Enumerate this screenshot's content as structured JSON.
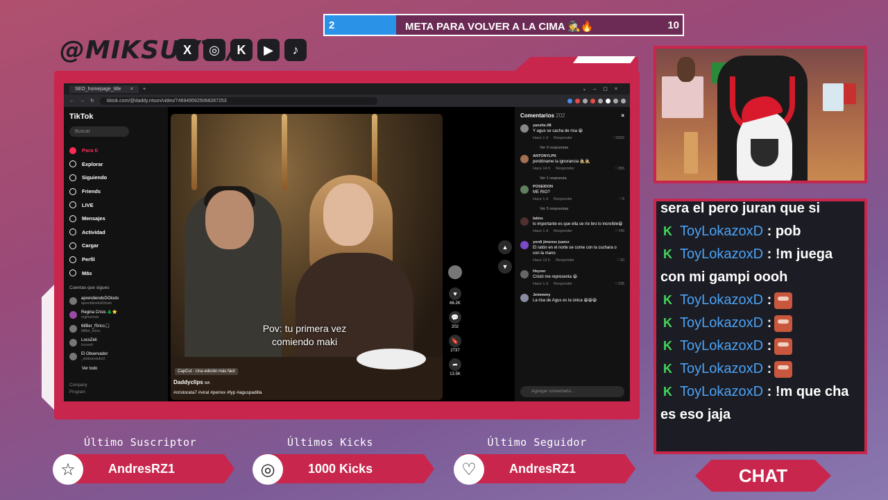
{
  "goal": {
    "current": "2",
    "title": "META PARA VOLVER A LA CIMA 🕵🔥",
    "max": "10",
    "progress": 0.2
  },
  "header": {
    "handle": "@MIKSUVT /",
    "socials": [
      "X",
      "◎",
      "K",
      "▶",
      "♪"
    ]
  },
  "browser": {
    "tab_title": "SEO_homepage_title",
    "url": "tiktok.com/@daddy.ntson/video/7469495925068287253"
  },
  "tiktok": {
    "logo": "TikTok",
    "search_placeholder": "Buscar",
    "nav": [
      "Para ti",
      "Explorar",
      "Siguiendo",
      "Friends",
      "LIVE",
      "Mensajes",
      "Actividad",
      "Cargar",
      "Perfil",
      "Más"
    ],
    "following_title": "Cuentas que sigues",
    "following": [
      {
        "name": "aprendiendoDOtodo",
        "handle": "aprendiendodOtodo"
      },
      {
        "name": "Regina Crisis 🌲⭐",
        "handle": "reginacrisis"
      },
      {
        "name": "6tlBer_fSrics🎧",
        "handle": "6tlBer_fsrics"
      },
      {
        "name": "LocoZeli",
        "handle": "locozeli"
      },
      {
        "name": "El Observador",
        "handle": "_elobservador2"
      }
    ],
    "see_all": "Ver todo",
    "company": "Company",
    "program": "Program",
    "video": {
      "caption": "Pov: tu primera vez comiendo maki",
      "capcut": "CapCut · Una edición más fácil",
      "author": "Daddyclips",
      "author_tag": "MA",
      "tags": "#cristorata7 #viral #perrex #fyp #aguspadilla"
    },
    "actions": [
      {
        "icon": "♥",
        "label": "66.2K"
      },
      {
        "icon": "💬",
        "label": "202"
      },
      {
        "icon": "🔖",
        "label": "2737"
      },
      {
        "icon": "➦",
        "label": "13.5K"
      }
    ],
    "comments_title": "Comentarios",
    "comments_count": "202",
    "comments": [
      {
        "user": "yanshe.08",
        "text": "Y agus se cacha de risa 😆",
        "time": "Hace 1 d",
        "reply": "Responder",
        "likes": "3322",
        "more": "Ver 9 respuestas"
      },
      {
        "user": "ANTONYLPK",
        "text": "perdóname la ignorancia 🕵🕵",
        "time": "Hace 14 h",
        "reply": "Responder",
        "likes": "355",
        "more": "Ver 1 respuesta"
      },
      {
        "user": "POSEIDON",
        "text": "ME RIO?",
        "time": "Hace 1 d",
        "reply": "Responder",
        "likes": "5",
        "more": "Ver 5 respuestas"
      },
      {
        "user": "latino",
        "text": "lo importante es que ella se ríe bro lo increíble😆",
        "time": "Hace 1 d",
        "reply": "Responder",
        "likes": "749",
        "more": ""
      },
      {
        "user": "yordi jimenez juarez",
        "text": "El ratón en el norte se come con la cuchara o con la mano",
        "time": "Hace 13 h",
        "reply": "Responder",
        "likes": "10",
        "more": ""
      },
      {
        "user": "Heyner",
        "text": "Cristó me representa 😆",
        "time": "Hace 1 d",
        "reply": "Responder",
        "likes": "235",
        "more": ""
      },
      {
        "user": "Jeimmmy",
        "text": "La risa de Agus es la única 😆😆😆",
        "time": "",
        "reply": "",
        "likes": "",
        "more": ""
      }
    ],
    "comment_placeholder": "Agregar comentario..."
  },
  "chat": {
    "top_partial": "sera el pero juran que si",
    "messages": [
      {
        "user": "ToyLokazoxD",
        "text": ": pob",
        "emote": false
      },
      {
        "user": "ToyLokazoxD",
        "text": ": !m juega con mi gampi oooh",
        "emote": false
      },
      {
        "user": "ToyLokazoxD",
        "text": ":",
        "emote": true
      },
      {
        "user": "ToyLokazoxD",
        "text": ":",
        "emote": true
      },
      {
        "user": "ToyLokazoxD",
        "text": ":",
        "emote": true
      },
      {
        "user": "ToyLokazoxD",
        "text": ":",
        "emote": true
      },
      {
        "user": "ToyLokazoxD",
        "text": ": !m que cha es eso jaja",
        "emote": false
      }
    ],
    "button": "CHAT"
  },
  "alerts": [
    {
      "title": "Último Suscriptor",
      "value": "AndresRZ1",
      "icon": "☆"
    },
    {
      "title": "Últimos Kicks",
      "value": "1000 Kicks",
      "icon": "◎"
    },
    {
      "title": "Último Seguidor",
      "value": "AndresRZ1",
      "icon": "♡"
    }
  ],
  "colors": {
    "accent": "#c8264c",
    "goal_fill": "#2a93e8",
    "chat_user": "#4ba3f5",
    "kick_green": "#42d85a",
    "tiktok_red": "#fe2c55"
  }
}
